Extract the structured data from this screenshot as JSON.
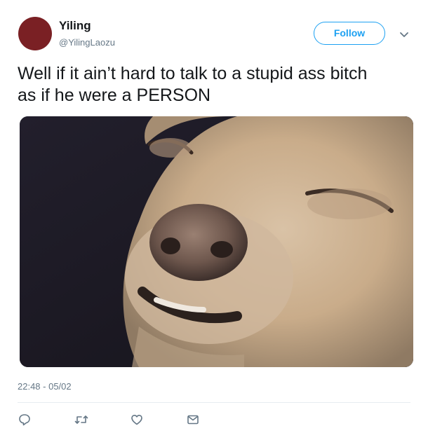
{
  "author": {
    "name": "Yiling",
    "handle": "@YilingLaozu",
    "avatar_color": "#7a2024"
  },
  "follow_label": "Follow",
  "tweet": {
    "text_line1": "Well if it ain’t hard to talk to a stupid ass bitch",
    "text_line2": "as if he were a PERSON",
    "timestamp": "22:48 - 05/02",
    "media_description_icon": "photo-dog-squinting"
  },
  "actions": {
    "reply_icon": "reply-icon",
    "retweet_icon": "retweet-icon",
    "like_icon": "heart-icon",
    "dm_icon": "envelope-icon"
  },
  "colors": {
    "accent": "#1da1f2",
    "secondary_text": "#657786",
    "primary_text": "#14171a",
    "divider": "#e6ecf0"
  }
}
